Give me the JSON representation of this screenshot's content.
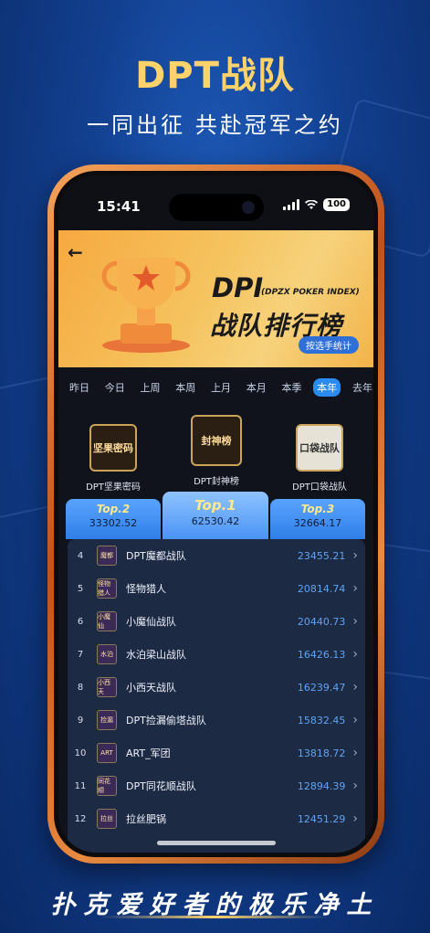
{
  "promo": {
    "title": "DPT战队",
    "subtitle": "一同出征 共赴冠军之约",
    "footer": "扑克爱好者的极乐净土"
  },
  "status": {
    "time": "15:41",
    "battery": "100"
  },
  "banner": {
    "brand": "DPI",
    "brand_sub": "(DPZX POKER INDEX)",
    "title": "战队排行榜",
    "stat_button": "按选手统计"
  },
  "tabs": [
    {
      "label": "昨日",
      "active": false
    },
    {
      "label": "今日",
      "active": false
    },
    {
      "label": "上周",
      "active": false
    },
    {
      "label": "本周",
      "active": false
    },
    {
      "label": "上月",
      "active": false
    },
    {
      "label": "本月",
      "active": false
    },
    {
      "label": "本季",
      "active": false
    },
    {
      "label": "本年",
      "active": true
    },
    {
      "label": "去年",
      "active": false
    }
  ],
  "podium": {
    "second": {
      "logo": "坚果密码",
      "name": "DPT坚果密码",
      "label": "Top.2",
      "score": "33302.52"
    },
    "first": {
      "logo": "封神榜",
      "name": "DPT封神榜",
      "label": "Top.1",
      "score": "62530.42"
    },
    "third": {
      "logo": "口袋战队",
      "name": "DPT口袋战队",
      "label": "Top.3",
      "score": "32664.17"
    }
  },
  "rows": [
    {
      "rank": "4",
      "avatar": "魔都",
      "team": "DPT魔都战队",
      "value": "23455.21"
    },
    {
      "rank": "5",
      "avatar": "怪物猎人",
      "team": "怪物猎人",
      "value": "20814.74"
    },
    {
      "rank": "6",
      "avatar": "小魔仙",
      "team": "小魔仙战队",
      "value": "20440.73"
    },
    {
      "rank": "7",
      "avatar": "水泊",
      "team": "水泊梁山战队",
      "value": "16426.13"
    },
    {
      "rank": "8",
      "avatar": "小西天",
      "team": "小西天战队",
      "value": "16239.47"
    },
    {
      "rank": "9",
      "avatar": "捡漏",
      "team": "DPT捡漏偷塔战队",
      "value": "15832.45"
    },
    {
      "rank": "10",
      "avatar": "ART",
      "team": "ART_军团",
      "value": "13818.72"
    },
    {
      "rank": "11",
      "avatar": "同花顺",
      "team": "DPT同花顺战队",
      "value": "12894.39"
    },
    {
      "rank": "12",
      "avatar": "拉丝",
      "team": "拉丝肥锅",
      "value": "12451.29"
    }
  ],
  "colors": {
    "accent": "#2a8cf0",
    "gold": "#ffd36a",
    "value": "#5fa4f2"
  }
}
